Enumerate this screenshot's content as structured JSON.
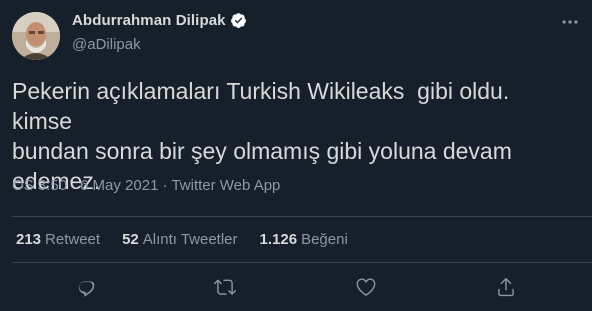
{
  "author": {
    "display_name": "Abdurrahman Dilipak",
    "handle": "@aDilipak",
    "verified": true
  },
  "tweet": {
    "text": "Pekerin açıklamaları Turkish Wikileaks  gibi oldu. kimse\nbundan sonra bir şey olmamış gibi yoluna devam\nedemez.",
    "time": "ÖS 3:50",
    "separator": "·",
    "date": "6 May 2021",
    "source": "Twitter Web App"
  },
  "stats": {
    "retweets": {
      "count": "213",
      "label": "Retweet"
    },
    "quotes": {
      "count": "52",
      "label": "Alıntı Tweetler"
    },
    "likes": {
      "count": "1.126",
      "label": "Beğeni"
    }
  },
  "icons": {
    "more": "more-options-icon",
    "reply": "reply-icon",
    "retweet": "retweet-icon",
    "like": "like-icon",
    "share": "share-icon",
    "verified": "verified-badge-icon"
  },
  "colors": {
    "background": "#15202b",
    "text": "#d9d9d9",
    "secondary": "#8b98a5",
    "border": "#38444d",
    "verified": "#ffffff"
  }
}
